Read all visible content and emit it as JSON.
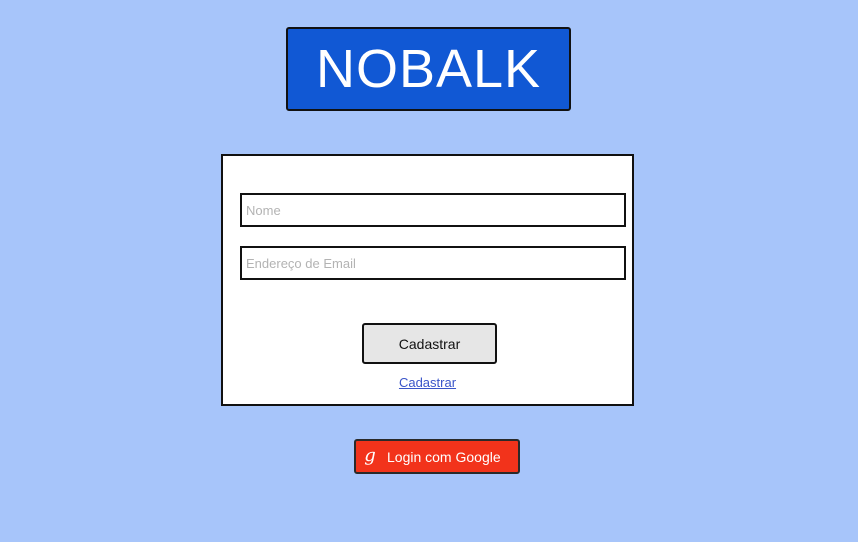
{
  "logo": {
    "text": "NOBALK"
  },
  "form": {
    "name_placeholder": "Nome",
    "name_value": "",
    "email_placeholder": "Endereço de Email",
    "email_value": "",
    "submit_label": "Cadastrar",
    "link_label": "Cadastrar"
  },
  "google": {
    "icon_glyph": "g",
    "icon_name": "google-icon",
    "label": "Login com Google"
  },
  "colors": {
    "background": "#a7c5fa",
    "logo_bg": "#1158d4",
    "google_bg": "#f2331b",
    "link": "#3a55c9"
  }
}
